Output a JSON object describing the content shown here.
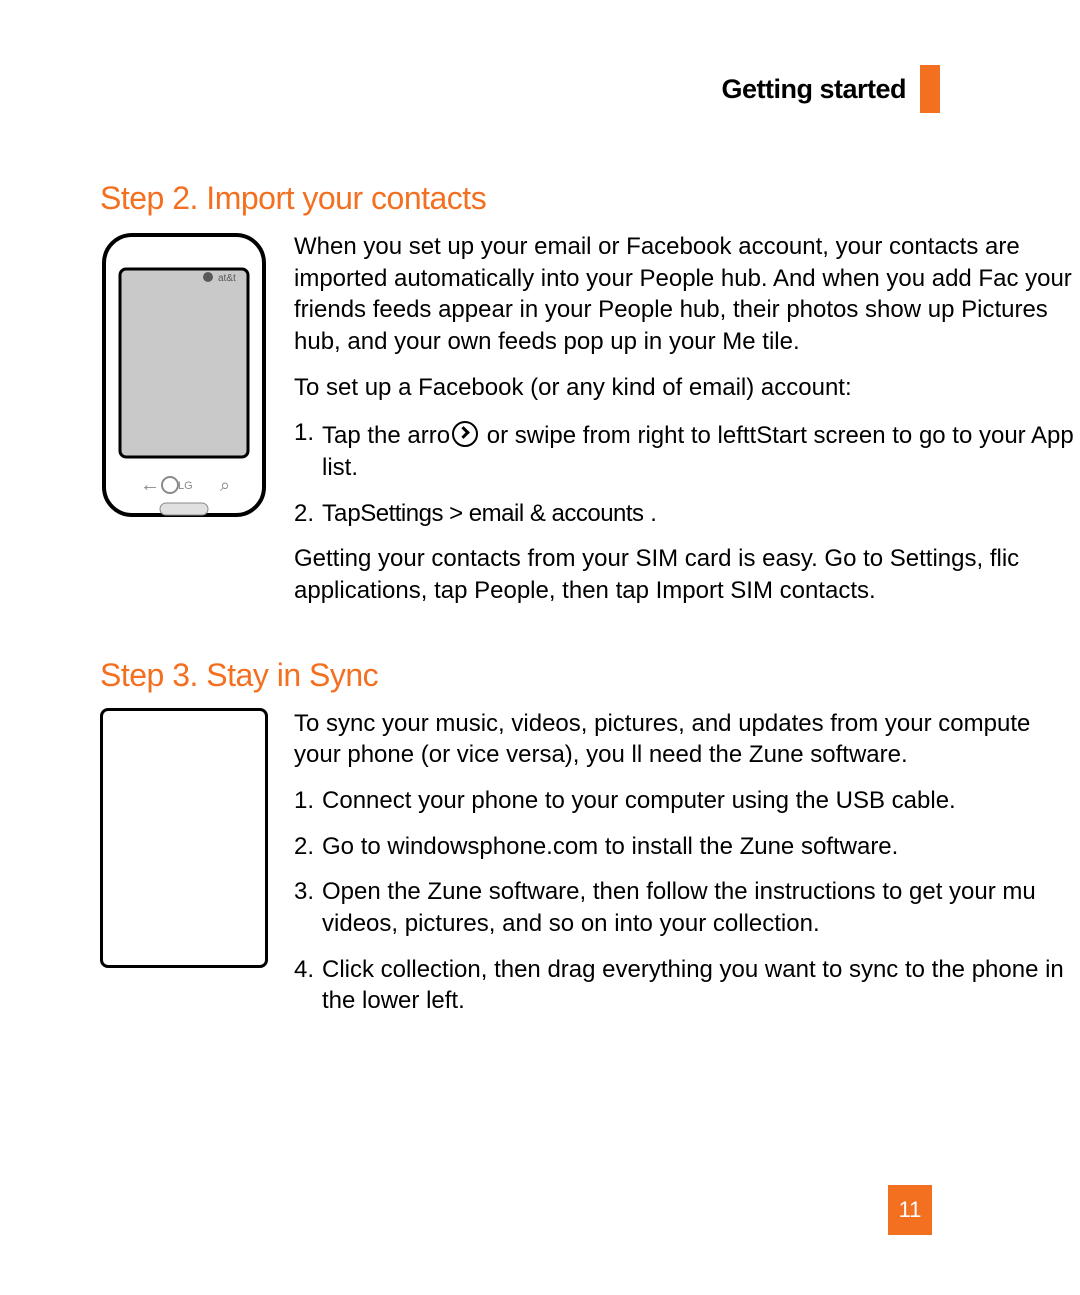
{
  "header": {
    "section_title": "Getting started"
  },
  "step2": {
    "heading": "Step 2. Import your contacts",
    "para1": "When you set up your email or Facebook account, your contacts are imported automatically into your People hub. And when you add Fac your friends  feeds appear in your People hub, their photos show up Pictures hub, and your own feeds pop up in your Me tile.",
    "para2": "To set up a Facebook (or any kind of email) account:",
    "li1_a": "Tap the arro",
    "li1_b": " or swipe from right to ",
    "li1_c": "leftt",
    "li1_d": "Start screen to go to your App list.",
    "li2_a": "Ta",
    "li2_b": "p",
    "li2_c": "Settings > email & accounts",
    "li2_d": "    .",
    "para3": "Getting your contacts from your SIM card is easy. Go to Settings, flic applications, tap People, then tap Import SIM contacts."
  },
  "step3": {
    "heading": "Step 3. Stay in Sync",
    "para1": "To sync your music, videos, pictures, and updates from your compute your phone (or vice versa), you ll need the Zune software.",
    "li1": "Connect your phone to your computer using the USB cable.",
    "li2": "Go to windowsphone.com to install the Zune software.",
    "li3": "Open the Zune software, then follow the instructions to get your mu videos, pictures, and so on into your collection.",
    "li4": "Click collection, then drag everything you want to sync to the phone in the lower left."
  },
  "page_number": "11",
  "accent_color": "#f37021"
}
